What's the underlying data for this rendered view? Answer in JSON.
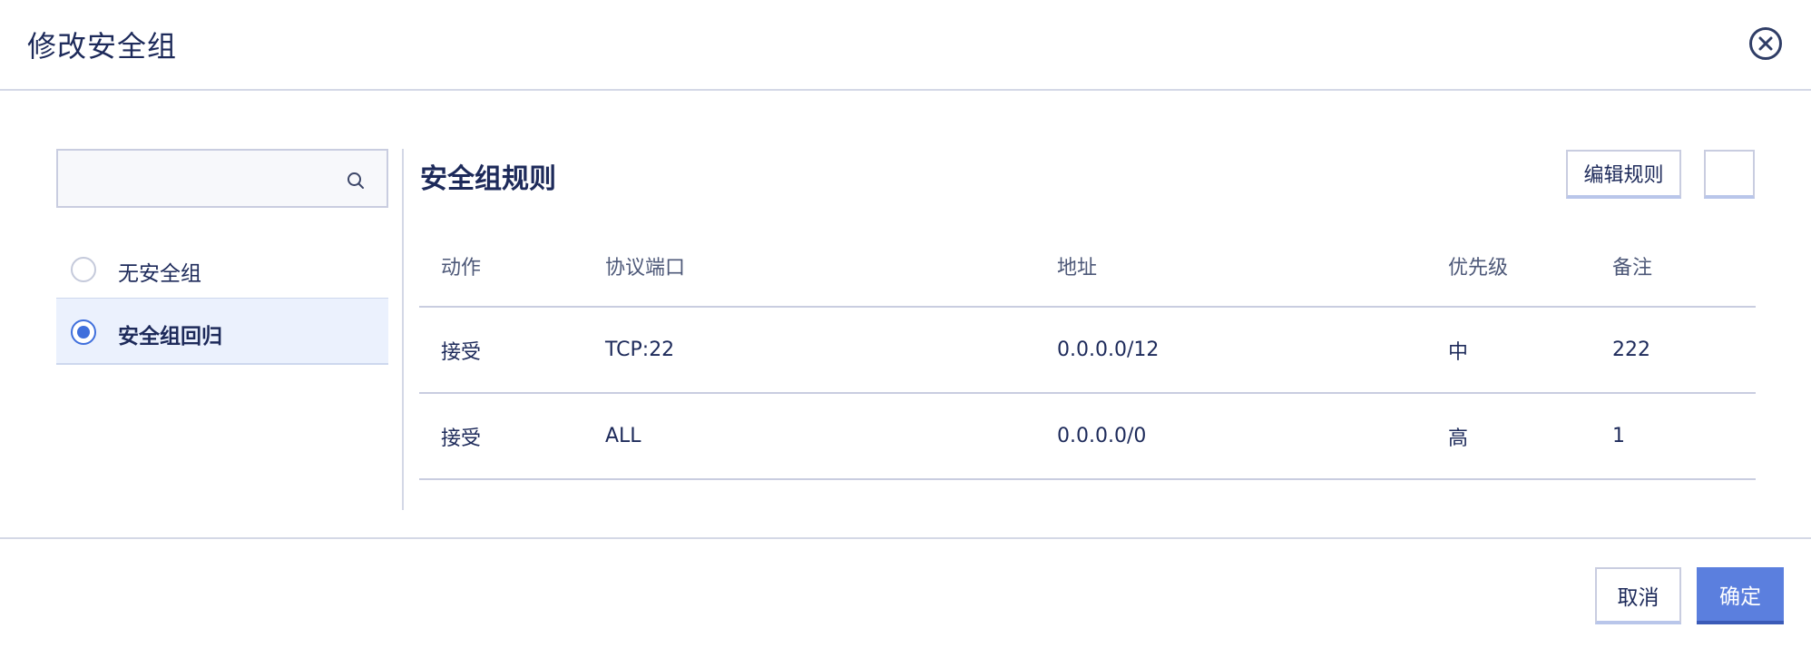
{
  "dialog": {
    "title": "修改安全组"
  },
  "left_panel": {
    "search": {
      "value": "",
      "placeholder": ""
    },
    "items": [
      {
        "label": "无安全组",
        "selected": false
      },
      {
        "label": "安全组回归",
        "selected": true
      }
    ]
  },
  "right_panel": {
    "title": "安全组规则",
    "edit_rules_label": "编辑规则",
    "table": {
      "headers": [
        "动作",
        "协议端口",
        "地址",
        "优先级",
        "备注"
      ],
      "rows": [
        [
          "接受",
          "TCP:22",
          "0.0.0.0/12",
          "中",
          "222"
        ],
        [
          "接受",
          "ALL",
          "0.0.0.0/0",
          "高",
          "1"
        ]
      ]
    }
  },
  "footer": {
    "cancel_label": "取消",
    "confirm_label": "确定"
  },
  "colors": {
    "primary": "#5b7fde",
    "selected_bg": "#ebf1fd",
    "text": "#1d2a5a",
    "border": "#c9cde0"
  },
  "icons": {
    "close": "close-circle-icon",
    "search": "search-icon"
  }
}
